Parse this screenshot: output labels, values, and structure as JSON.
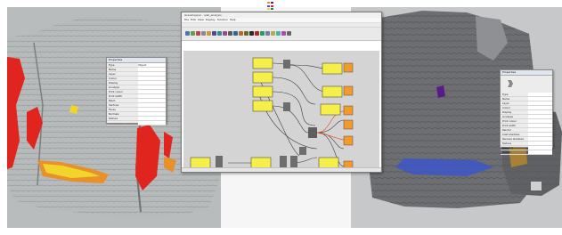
{
  "props_left": {
    "title": "Properties",
    "rows": [
      {
        "k": "Type",
        "v": "Object"
      },
      {
        "k": "Name",
        "v": ""
      },
      {
        "k": "Layer",
        "v": ""
      },
      {
        "k": "Colour",
        "v": ""
      },
      {
        "k": "Display",
        "v": ""
      },
      {
        "k": "Linetype",
        "v": ""
      },
      {
        "k": "Print colour",
        "v": ""
      },
      {
        "k": "Print width",
        "v": ""
      },
      {
        "k": "Mesh",
        "v": ""
      },
      {
        "k": "Vertices",
        "v": ""
      },
      {
        "k": "Faces",
        "v": ""
      },
      {
        "k": "Normals",
        "v": ""
      },
      {
        "k": "Texture",
        "v": ""
      },
      {
        "k": "",
        "v": ""
      }
    ]
  },
  "props_right": {
    "title": "Properties",
    "rows": [
      {
        "k": "Type",
        "v": ""
      },
      {
        "k": "Name",
        "v": ""
      },
      {
        "k": "Layer",
        "v": ""
      },
      {
        "k": "Colour",
        "v": ""
      },
      {
        "k": "Display",
        "v": ""
      },
      {
        "k": "Linetype",
        "v": ""
      },
      {
        "k": "Print colour",
        "v": ""
      },
      {
        "k": "Print width",
        "v": ""
      },
      {
        "k": "Render",
        "v": ""
      },
      {
        "k": "Cast shadows",
        "v": ""
      },
      {
        "k": "Receive shadows",
        "v": ""
      },
      {
        "k": "Texture",
        "v": ""
      },
      {
        "k": "Mapping",
        "v": ""
      },
      {
        "k": "Details",
        "v": ""
      }
    ]
  },
  "gh": {
    "title": "Grasshopper - wall_analysis",
    "menu": [
      "File",
      "Edit",
      "View",
      "Display",
      "Solution",
      "Help"
    ]
  },
  "colors": {
    "erosion_red": "#e0241e",
    "orange_zone": "#e8902a",
    "yellow_zone": "#f2d52a",
    "purple_zone": "#5a1a8a",
    "blue_zone": "#3c56c8",
    "gh_component": "#f6ef4a",
    "gh_panel": "#f29a2a",
    "gh_wire_red": "#e4561e"
  },
  "icons": {
    "panel_logo": "rhino-logo-icon"
  }
}
